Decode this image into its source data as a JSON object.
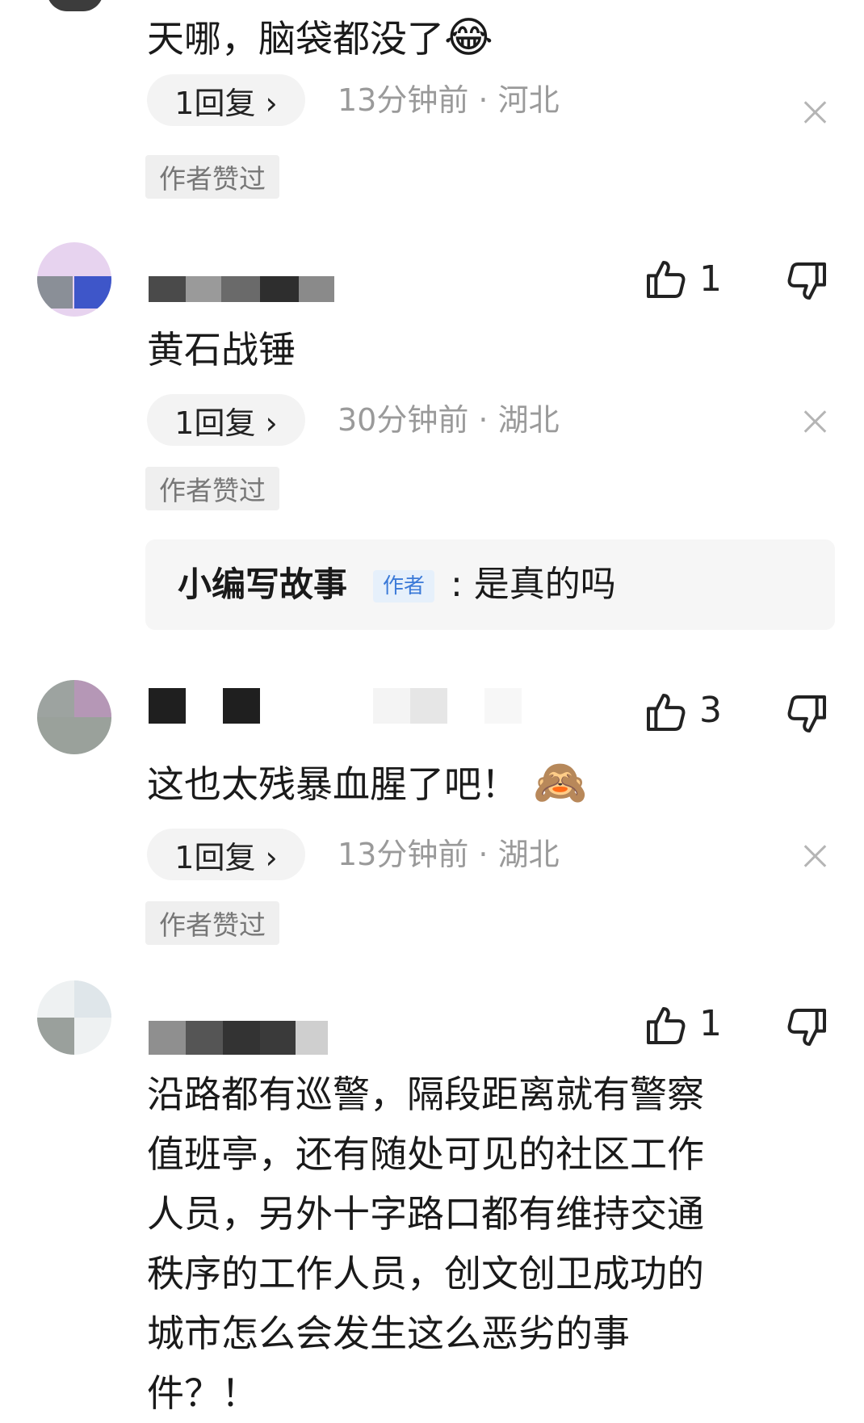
{
  "comment_0": {
    "text": "天哪，脑袋都没了",
    "emoji": "😂",
    "reply": "1回复 ›",
    "meta": "13分钟前 · 河北",
    "badge": "作者赞过"
  },
  "comment_1": {
    "likes": "1",
    "text": "黄石战锤",
    "reply": "1回复 ›",
    "meta": "30分钟前 · 湖北",
    "badge": "作者赞过",
    "author_reply": {
      "name": "小编写故事",
      "tag": "作者",
      "text": ": 是真的吗"
    }
  },
  "comment_2": {
    "likes": "3",
    "text": "这也太残暴血腥了吧！",
    "emoji": "🙈",
    "reply": "1回复 ›",
    "meta": "13分钟前 · 湖北",
    "badge": "作者赞过"
  },
  "comment_3": {
    "likes": "1",
    "text_lines": [
      "沿路都有巡警，隔段距离就有警察",
      "值班亭，还有随处可见的社区工作",
      "人员，另外十字路口都有维持交通",
      "秩序的工作人员，创文创卫成功的",
      "城市怎么会发生这么恶劣的事",
      "件？！"
    ]
  },
  "icons": {
    "like": "thumbs-up-outline",
    "dislike": "thumbs-down-outline",
    "close": "close-x"
  }
}
